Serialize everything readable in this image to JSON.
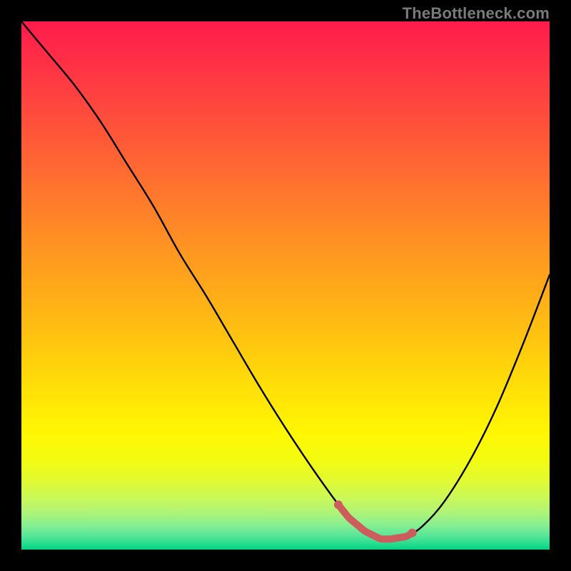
{
  "watermark": {
    "text": "TheBottleneck.com"
  },
  "chart_data": {
    "type": "line",
    "title": "",
    "xlabel": "",
    "ylabel": "",
    "xlim": [
      0,
      100
    ],
    "ylim": [
      0,
      100
    ],
    "series": [
      {
        "name": "bottleneck-curve",
        "x": [
          0,
          5,
          10,
          15,
          20,
          25,
          30,
          35,
          40,
          45,
          50,
          55,
          60,
          62,
          65,
          68,
          70,
          73,
          76,
          80,
          85,
          90,
          95,
          100
        ],
        "y": [
          100,
          94,
          88,
          81,
          73,
          65,
          56,
          48,
          39.5,
          31,
          23,
          15.5,
          8.5,
          6,
          3.5,
          2,
          2,
          2.5,
          4.5,
          9,
          17,
          27,
          39,
          52
        ]
      }
    ],
    "highlight_band": {
      "name": "optimal-range",
      "x_start": 60,
      "x_end": 74,
      "color": "#cd5c5c"
    },
    "gradient_stops": [
      {
        "offset": 0.0,
        "color": "#ff1b4b"
      },
      {
        "offset": 0.06,
        "color": "#ff2b47"
      },
      {
        "offset": 0.14,
        "color": "#ff4140"
      },
      {
        "offset": 0.22,
        "color": "#ff5838"
      },
      {
        "offset": 0.3,
        "color": "#ff6f30"
      },
      {
        "offset": 0.38,
        "color": "#ff8627"
      },
      {
        "offset": 0.46,
        "color": "#ff9d1e"
      },
      {
        "offset": 0.54,
        "color": "#ffb316"
      },
      {
        "offset": 0.62,
        "color": "#ffca0e"
      },
      {
        "offset": 0.7,
        "color": "#ffe107"
      },
      {
        "offset": 0.78,
        "color": "#fff702"
      },
      {
        "offset": 0.83,
        "color": "#f3fb11"
      },
      {
        "offset": 0.87,
        "color": "#e2fa33"
      },
      {
        "offset": 0.9,
        "color": "#ccf856"
      },
      {
        "offset": 0.93,
        "color": "#aef479"
      },
      {
        "offset": 0.955,
        "color": "#85ee92"
      },
      {
        "offset": 0.975,
        "color": "#54e598"
      },
      {
        "offset": 0.99,
        "color": "#25dc8f"
      },
      {
        "offset": 1.0,
        "color": "#00d484"
      }
    ]
  }
}
